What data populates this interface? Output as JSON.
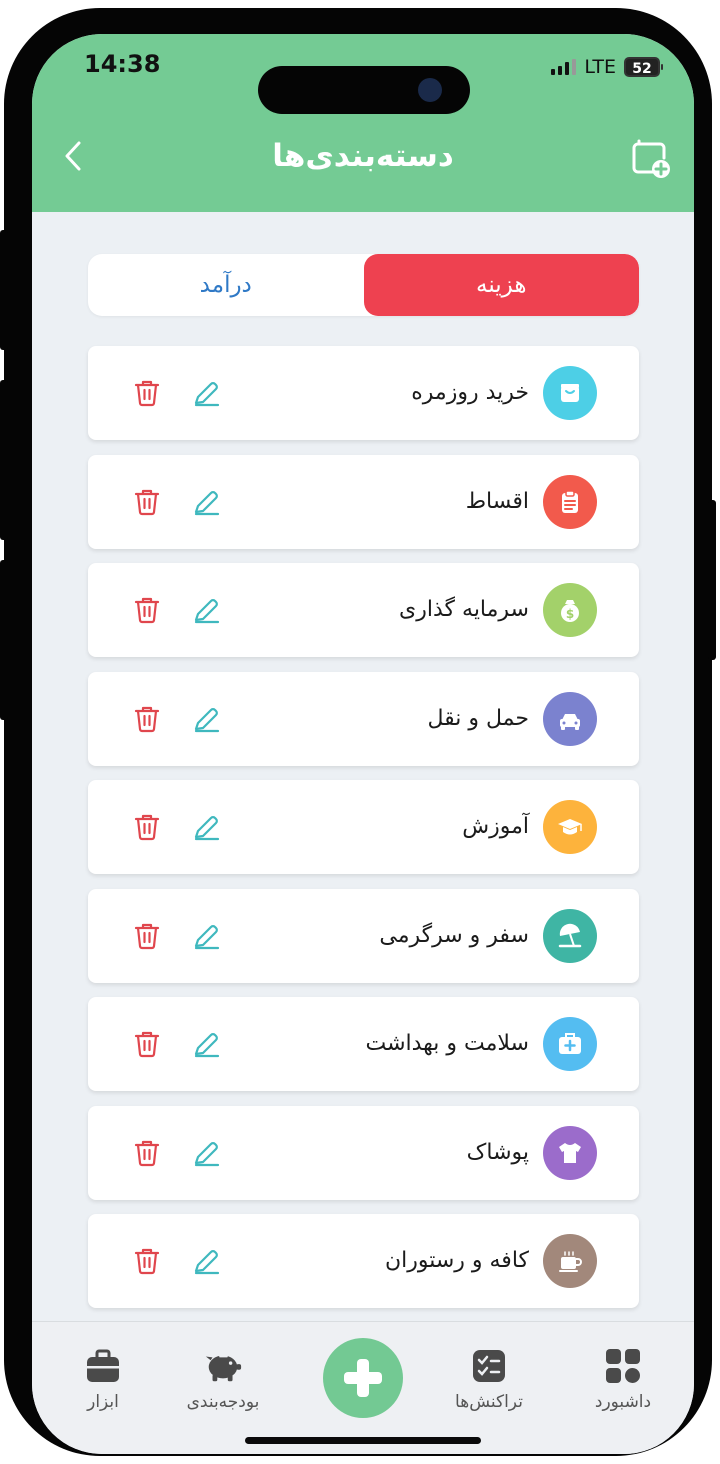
{
  "status": {
    "time": "14:38",
    "network": "LTE",
    "battery": "52"
  },
  "header": {
    "title": "دسته‌بندی‌ها"
  },
  "tabs": [
    {
      "label": "هزینه",
      "active": true
    },
    {
      "label": "درآمد",
      "active": false
    }
  ],
  "categories": [
    {
      "label": "خرید روزمره",
      "icon": "shopping-box-icon",
      "color": "#4dcfe6"
    },
    {
      "label": "اقساط",
      "icon": "clipboard-icon",
      "color": "#f25a4c"
    },
    {
      "label": "سرمایه گذاری",
      "icon": "money-bag-icon",
      "color": "#a3d16a"
    },
    {
      "label": "حمل و نقل",
      "icon": "car-icon",
      "color": "#7b82cf"
    },
    {
      "label": "آموزش",
      "icon": "graduation-cap-icon",
      "color": "#fdb33c"
    },
    {
      "label": "سفر و سرگرمی",
      "icon": "beach-umbrella-icon",
      "color": "#3fb5a4"
    },
    {
      "label": "سلامت و بهداشت",
      "icon": "first-aid-kit-icon",
      "color": "#54bdf1"
    },
    {
      "label": "پوشاک",
      "icon": "tshirt-icon",
      "color": "#9b6ccb"
    },
    {
      "label": "کافه و رستوران",
      "icon": "coffee-cup-icon",
      "color": "#a2887b"
    }
  ],
  "nav": {
    "tools": "ابزار",
    "budget": "بودجه‌بندی",
    "transactions": "تراکنش‌ها",
    "dashboard": "داشبورد"
  },
  "colors": {
    "header": "#74cb94",
    "expense": "#ee4150",
    "income": "#2f79c6",
    "edit": "#3fb8be",
    "delete": "#e0464d"
  }
}
